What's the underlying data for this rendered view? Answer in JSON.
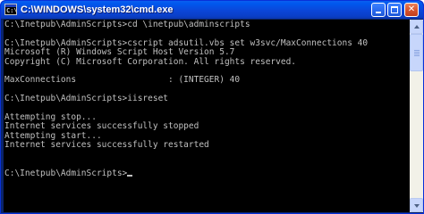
{
  "window": {
    "title": "C:\\WINDOWS\\system32\\cmd.exe",
    "icon": "command-prompt-icon"
  },
  "caption_buttons": {
    "minimize": "minimize-icon",
    "maximize": "maximize-icon",
    "close_label": "✕"
  },
  "console": {
    "lines": [
      "C:\\Inetpub\\AdminScripts>cd \\inetpub\\adminscripts",
      "",
      "C:\\Inetpub\\AdminScripts>cscript adsutil.vbs set w3svc/MaxConnections 40",
      "Microsoft (R) Windows Script Host Version 5.7",
      "Copyright (C) Microsoft Corporation. All rights reserved.",
      "",
      "MaxConnections                  : (INTEGER) 40",
      "",
      "C:\\Inetpub\\AdminScripts>iisreset",
      "",
      "Attempting stop...",
      "Internet services successfully stopped",
      "Attempting start...",
      "Internet services successfully restarted",
      "",
      "",
      "C:\\Inetpub\\AdminScripts>"
    ]
  },
  "colors": {
    "titlebar": "#0a46d8",
    "console_background": "#000000",
    "console_text": "#c0c0c0",
    "close_button": "#d8552f"
  }
}
